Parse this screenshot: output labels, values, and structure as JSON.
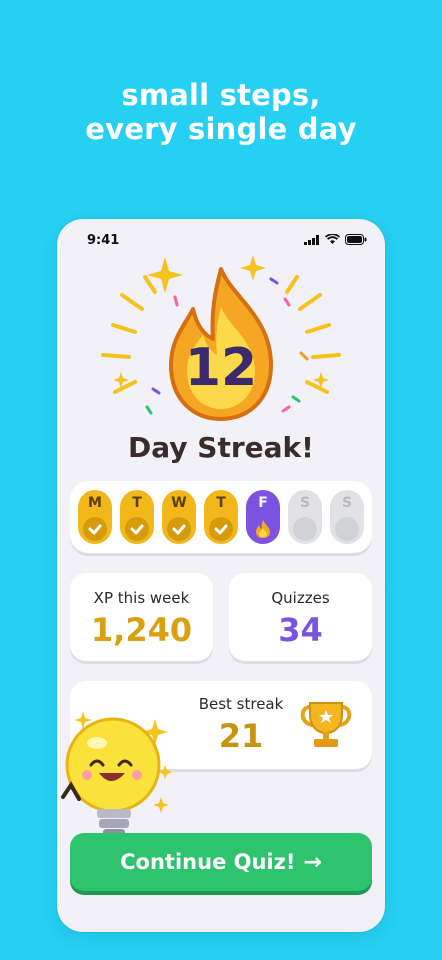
{
  "promo": {
    "line1": "small steps,",
    "line2": "every single day"
  },
  "status_bar": {
    "time": "9:41"
  },
  "streak": {
    "count": "12",
    "label": "Day Streak!"
  },
  "week": [
    {
      "letter": "M",
      "state": "done"
    },
    {
      "letter": "T",
      "state": "done"
    },
    {
      "letter": "W",
      "state": "done"
    },
    {
      "letter": "T",
      "state": "done"
    },
    {
      "letter": "F",
      "state": "today"
    },
    {
      "letter": "S",
      "state": "upcoming"
    },
    {
      "letter": "S",
      "state": "upcoming"
    }
  ],
  "stats": {
    "xp": {
      "caption": "XP this week",
      "value": "1,240"
    },
    "quizzes": {
      "caption": "Quizzes",
      "value": "34"
    },
    "best": {
      "caption": "Best streak",
      "value": "21"
    }
  },
  "cta": {
    "label": "Continue Quiz!",
    "arrow": "→"
  },
  "colors": {
    "background": "#25d0f3",
    "gold": "#f2b81b",
    "purple": "#7b53e0",
    "green": "#2ec46e",
    "card": "#ffffff"
  },
  "icons": [
    "flame-icon",
    "check-icon",
    "trophy-icon",
    "lightbulb-mascot",
    "arrow-right-icon",
    "signal-icon",
    "wifi-icon",
    "battery-icon"
  ]
}
